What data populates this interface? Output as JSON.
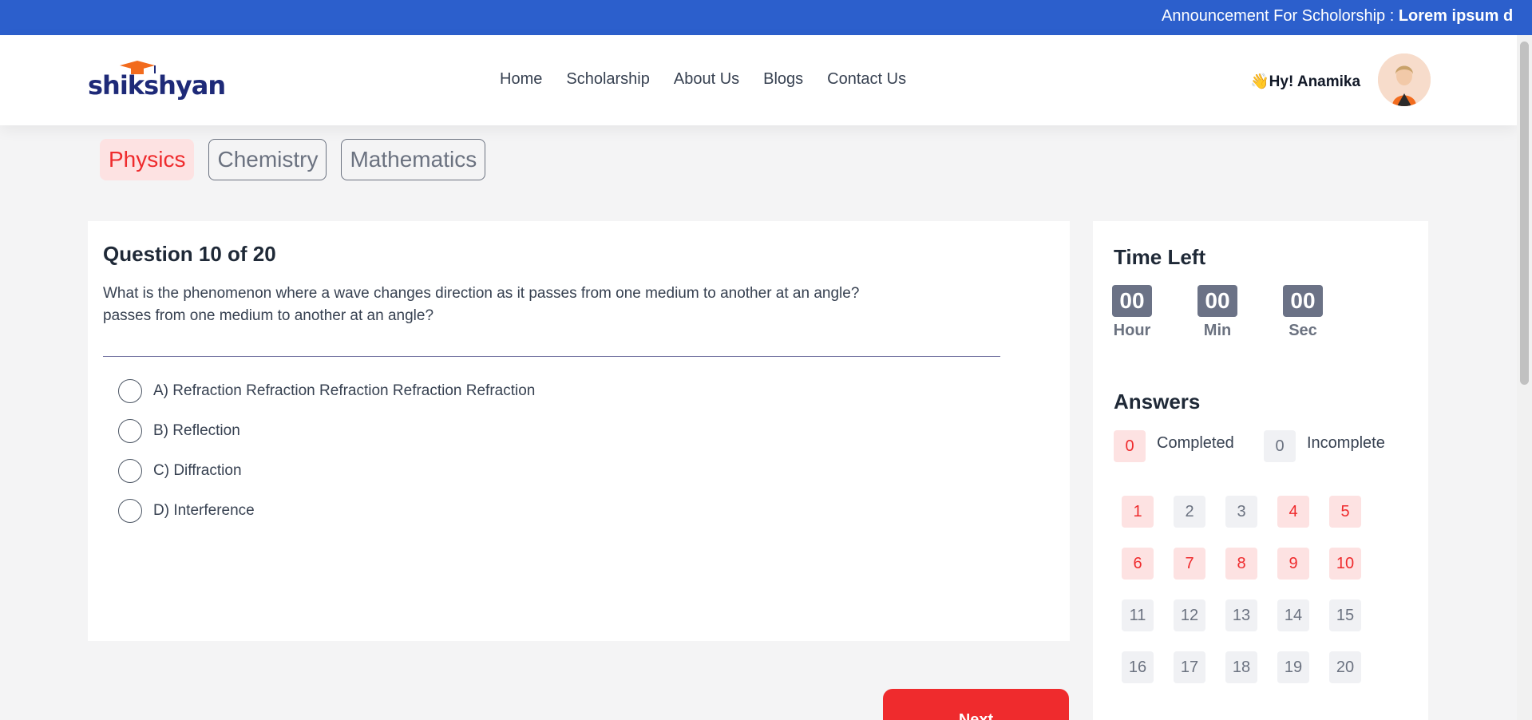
{
  "announcement": {
    "prefix": "Announcement For Scholorship : ",
    "text": "Lorem ipsum d"
  },
  "header": {
    "logo_text": "shikshyan",
    "nav": [
      "Home",
      "Scholarship",
      "About Us",
      "Blogs",
      "Contact Us"
    ],
    "greeting": "👋Hy! Anamika"
  },
  "subjects": [
    {
      "label": "Physics",
      "active": true
    },
    {
      "label": "Chemistry",
      "active": false
    },
    {
      "label": "Mathematics",
      "active": false
    }
  ],
  "question": {
    "title": "Question 10 of 20",
    "text_line1": "What is the phenomenon where a wave changes direction as it passes from one medium to another at an angle?",
    "text_line2": "passes from one medium to another at an angle?",
    "options": [
      "A) Refraction Refraction Refraction Refraction Refraction",
      "B) Reflection",
      "C) Diffraction",
      "D) Interference"
    ]
  },
  "next_label": "Next",
  "timer": {
    "title": "Time Left",
    "hours": "00",
    "minutes": "00",
    "seconds": "00",
    "hour_label": "Hour",
    "min_label": "Min",
    "sec_label": "Sec"
  },
  "answers": {
    "title": "Answers",
    "completed_count": "0",
    "completed_label": "Completed",
    "incomplete_count": "0",
    "incomplete_label": "Incomplete",
    "numbers": [
      {
        "n": "1",
        "done": true
      },
      {
        "n": "2",
        "done": false
      },
      {
        "n": "3",
        "done": false
      },
      {
        "n": "4",
        "done": true
      },
      {
        "n": "5",
        "done": true
      },
      {
        "n": "6",
        "done": true
      },
      {
        "n": "7",
        "done": true
      },
      {
        "n": "8",
        "done": true
      },
      {
        "n": "9",
        "done": true
      },
      {
        "n": "10",
        "done": true
      },
      {
        "n": "11",
        "done": false
      },
      {
        "n": "12",
        "done": false
      },
      {
        "n": "13",
        "done": false
      },
      {
        "n": "14",
        "done": false
      },
      {
        "n": "15",
        "done": false
      },
      {
        "n": "16",
        "done": false
      },
      {
        "n": "17",
        "done": false
      },
      {
        "n": "18",
        "done": false
      },
      {
        "n": "19",
        "done": false
      },
      {
        "n": "20",
        "done": false
      }
    ]
  },
  "colors": {
    "accent": "#ef2b2d",
    "announce_bg": "#2c5fcc",
    "brand_navy": "#1e2a78",
    "brand_orange": "#f26b1d"
  }
}
